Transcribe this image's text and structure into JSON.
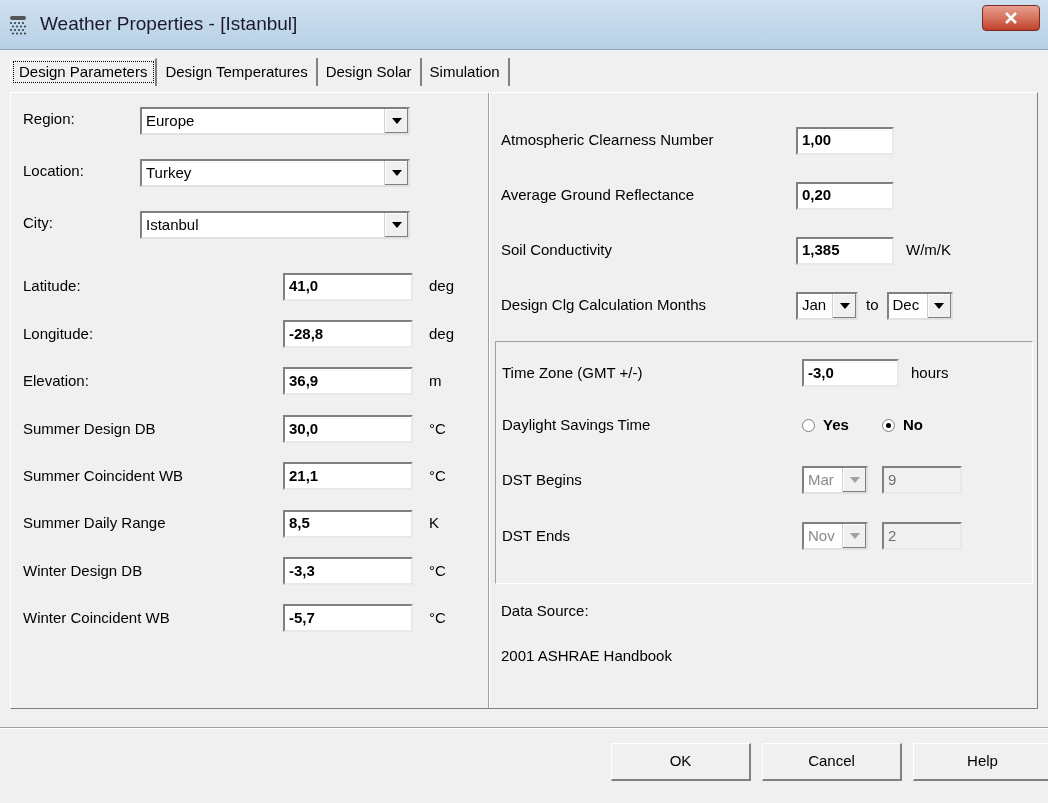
{
  "window": {
    "title": "Weather Properties - [Istanbul]"
  },
  "tabs": [
    {
      "label": "Design Parameters",
      "selected": true
    },
    {
      "label": "Design Temperatures",
      "selected": false
    },
    {
      "label": "Design Solar",
      "selected": false
    },
    {
      "label": "Simulation",
      "selected": false
    }
  ],
  "location": [
    {
      "label": "Region:",
      "value": "Europe"
    },
    {
      "label": "Location:",
      "value": "Turkey"
    },
    {
      "label": "City:",
      "value": "Istanbul"
    }
  ],
  "design_values": [
    {
      "label": "Latitude:",
      "value": "41,0",
      "unit": "deg"
    },
    {
      "label": "Longitude:",
      "value": "-28,8",
      "unit": "deg"
    },
    {
      "label": "Elevation:",
      "value": "36,9",
      "unit": "m"
    },
    {
      "label": "Summer Design DB",
      "value": "30,0",
      "unit": "°C"
    },
    {
      "label": "Summer Coincident WB",
      "value": "21,1",
      "unit": "°C"
    },
    {
      "label": "Summer Daily Range",
      "value": "8,5",
      "unit": "K"
    },
    {
      "label": "Winter Design DB",
      "value": "-3,3",
      "unit": "°C"
    },
    {
      "label": "Winter Coincident WB",
      "value": "-5,7",
      "unit": "°C"
    }
  ],
  "solar_values": [
    {
      "label": "Atmospheric Clearness Number",
      "value": "1,00"
    },
    {
      "label": "Average Ground Reflectance",
      "value": "0,20"
    },
    {
      "label": "Soil Conductivity",
      "value": "1,385",
      "unit": "W/m/K"
    }
  ],
  "calc_months": {
    "label": "Design Clg Calculation Months",
    "from": "Jan",
    "to_label": "to",
    "to": "Dec"
  },
  "time_zone": {
    "label": "Time Zone (GMT +/-)",
    "value": "-3,0",
    "unit": "hours"
  },
  "daylight_savings": {
    "label": "Daylight Savings Time",
    "options": [
      {
        "label": "Yes",
        "selected": false
      },
      {
        "label": "No",
        "selected": true
      }
    ]
  },
  "dst": [
    {
      "label": "DST Begins",
      "month": "Mar",
      "day": "9",
      "disabled": true
    },
    {
      "label": "DST Ends",
      "month": "Nov",
      "day": "2",
      "disabled": true
    }
  ],
  "data_source": {
    "label": "Data Source:",
    "value": "2001 ASHRAE Handbook"
  },
  "buttons": [
    "OK",
    "Cancel",
    "Help"
  ]
}
